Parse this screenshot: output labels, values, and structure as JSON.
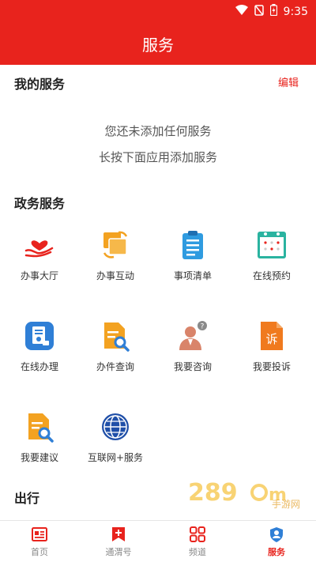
{
  "status_bar": {
    "time": "9:35"
  },
  "header": {
    "title": "服务"
  },
  "my_services": {
    "title": "我的服务",
    "edit_label": "编辑",
    "empty_line1": "您还未添加任何服务",
    "empty_line2": "长按下面应用添加服务"
  },
  "gov_services": {
    "title": "政务服务",
    "items": [
      {
        "label": "办事大厅",
        "icon": "heart-hand-icon"
      },
      {
        "label": "办事互动",
        "icon": "interaction-icon"
      },
      {
        "label": "事项清单",
        "icon": "clipboard-list-icon"
      },
      {
        "label": "在线预约",
        "icon": "calendar-icon"
      },
      {
        "label": "在线办理",
        "icon": "online-process-icon"
      },
      {
        "label": "办件查询",
        "icon": "document-search-icon"
      },
      {
        "label": "我要咨询",
        "icon": "consult-icon"
      },
      {
        "label": "我要投诉",
        "icon": "complaint-icon"
      },
      {
        "label": "我要建议",
        "icon": "suggestion-icon"
      },
      {
        "label": "互联网+服务",
        "icon": "globe-icon"
      }
    ]
  },
  "travel": {
    "title": "出行"
  },
  "watermark": {
    "text": "手游网"
  },
  "tabs": [
    {
      "label": "首页",
      "icon": "home-news-icon",
      "active": false
    },
    {
      "label": "通渭号",
      "icon": "plus-bookmark-icon",
      "active": false
    },
    {
      "label": "频道",
      "icon": "grid-icon",
      "active": false
    },
    {
      "label": "服务",
      "icon": "service-icon",
      "active": true
    }
  ],
  "colors": {
    "brand_red": "#e8231d",
    "icon_orange": "#f3a221",
    "icon_blue": "#2f7fd6",
    "icon_teal": "#2ab3a0"
  }
}
